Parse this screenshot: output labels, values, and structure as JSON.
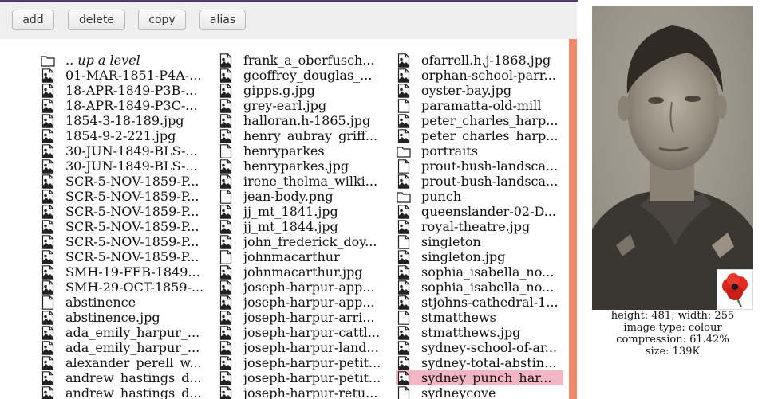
{
  "toolbar": {
    "add_label": "add",
    "delete_label": "delete",
    "copy_label": "copy",
    "alias_label": "alias"
  },
  "files": {
    "columns": [
      [
        {
          "name": ".. up a level",
          "icon": "folder-icon",
          "up": true
        },
        {
          "name": "01-MAR-1851-P4A-...",
          "icon": "image-file-icon"
        },
        {
          "name": "18-APR-1849-P3B-...",
          "icon": "image-file-icon"
        },
        {
          "name": "18-APR-1849-P3C-...",
          "icon": "image-file-icon"
        },
        {
          "name": "1854-3-18-189.jpg",
          "icon": "image-file-icon"
        },
        {
          "name": "1854-9-2-221.jpg",
          "icon": "image-file-icon"
        },
        {
          "name": "30-JUN-1849-BLS-...",
          "icon": "image-file-icon"
        },
        {
          "name": "30-JUN-1849-BLS-...",
          "icon": "image-file-icon"
        },
        {
          "name": "SCR-5-NOV-1859-P...",
          "icon": "image-file-icon"
        },
        {
          "name": "SCR-5-NOV-1859-P...",
          "icon": "image-file-icon"
        },
        {
          "name": "SCR-5-NOV-1859-P...",
          "icon": "image-file-icon"
        },
        {
          "name": "SCR-5-NOV-1859-P...",
          "icon": "image-file-icon"
        },
        {
          "name": "SCR-5-NOV-1859-P...",
          "icon": "image-file-icon"
        },
        {
          "name": "SCR-5-NOV-1859-P...",
          "icon": "image-file-icon"
        },
        {
          "name": "SMH-19-FEB-1849...",
          "icon": "image-file-icon"
        },
        {
          "name": "SMH-29-OCT-1859-...",
          "icon": "image-file-icon"
        },
        {
          "name": "abstinence",
          "icon": "blank-file-icon"
        },
        {
          "name": "abstinence.jpg",
          "icon": "image-file-icon"
        },
        {
          "name": "ada_emily_harpur_...",
          "icon": "image-file-icon"
        },
        {
          "name": "ada_emily_harpur_...",
          "icon": "image-file-icon"
        },
        {
          "name": "alexander_perell_w...",
          "icon": "image-file-icon"
        },
        {
          "name": "andrew_hastings_d...",
          "icon": "image-file-icon"
        },
        {
          "name": "andrew_hastings_d...",
          "icon": "image-file-icon"
        }
      ],
      [
        {
          "name": "frank_a_oberfusch...",
          "icon": "image-file-icon"
        },
        {
          "name": "geoffrey_douglas_...",
          "icon": "image-file-icon"
        },
        {
          "name": "gipps.g.jpg",
          "icon": "image-file-icon"
        },
        {
          "name": "grey-earl.jpg",
          "icon": "image-file-icon"
        },
        {
          "name": "halloran.h-1865.jpg",
          "icon": "image-file-icon"
        },
        {
          "name": "henry_aubray_griff...",
          "icon": "image-file-icon"
        },
        {
          "name": "henryparkes",
          "icon": "blank-file-icon"
        },
        {
          "name": "henryparkes.jpg",
          "icon": "image-file-icon"
        },
        {
          "name": "irene_thelma_wilki...",
          "icon": "image-file-icon"
        },
        {
          "name": "jean-body.png",
          "icon": "blank-file-icon"
        },
        {
          "name": "jj_mt_1841.jpg",
          "icon": "image-file-icon"
        },
        {
          "name": "jj_mt_1844.jpg",
          "icon": "image-file-icon"
        },
        {
          "name": "john_frederick_doy...",
          "icon": "image-file-icon"
        },
        {
          "name": "johnmacarthur",
          "icon": "blank-file-icon"
        },
        {
          "name": "johnmacarthur.jpg",
          "icon": "image-file-icon"
        },
        {
          "name": "joseph-harpur-app...",
          "icon": "image-file-icon"
        },
        {
          "name": "joseph-harpur-app...",
          "icon": "image-file-icon"
        },
        {
          "name": "joseph-harpur-arri...",
          "icon": "image-file-icon"
        },
        {
          "name": "joseph-harpur-cattl...",
          "icon": "image-file-icon"
        },
        {
          "name": "joseph-harpur-land...",
          "icon": "image-file-icon"
        },
        {
          "name": "joseph-harpur-petit...",
          "icon": "image-file-icon"
        },
        {
          "name": "joseph-harpur-petit...",
          "icon": "image-file-icon"
        },
        {
          "name": "joseph-harpur-retu...",
          "icon": "image-file-icon"
        }
      ],
      [
        {
          "name": "ofarrell.h.j-1868.jpg",
          "icon": "image-file-icon"
        },
        {
          "name": "orphan-school-parr...",
          "icon": "image-file-icon"
        },
        {
          "name": "oyster-bay.jpg",
          "icon": "image-file-icon"
        },
        {
          "name": "paramatta-old-mill",
          "icon": "blank-file-icon"
        },
        {
          "name": "peter_charles_harp...",
          "icon": "image-file-icon"
        },
        {
          "name": "peter_charles_harp...",
          "icon": "image-file-icon"
        },
        {
          "name": "portraits",
          "icon": "folder-icon"
        },
        {
          "name": "prout-bush-landsca...",
          "icon": "blank-file-icon"
        },
        {
          "name": "prout-bush-landsca...",
          "icon": "image-file-icon"
        },
        {
          "name": "punch",
          "icon": "folder-icon"
        },
        {
          "name": "queenslander-02-D...",
          "icon": "image-file-icon"
        },
        {
          "name": "royal-theatre.jpg",
          "icon": "image-file-icon"
        },
        {
          "name": "singleton",
          "icon": "blank-file-icon"
        },
        {
          "name": "singleton.jpg",
          "icon": "image-file-icon"
        },
        {
          "name": "sophia_isabella_no...",
          "icon": "image-file-icon"
        },
        {
          "name": "sophia_isabella_no...",
          "icon": "image-file-icon"
        },
        {
          "name": "stjohns-cathedral-1...",
          "icon": "image-file-icon"
        },
        {
          "name": "stmatthews",
          "icon": "blank-file-icon"
        },
        {
          "name": "stmatthews.jpg",
          "icon": "image-file-icon"
        },
        {
          "name": "sydney-school-of-ar...",
          "icon": "image-file-icon"
        },
        {
          "name": "sydney-total-abstin...",
          "icon": "image-file-icon"
        },
        {
          "name": "sydney_punch_har...",
          "icon": "image-file-icon",
          "selected": true
        },
        {
          "name": "sydneycove",
          "icon": "blank-file-icon"
        }
      ]
    ]
  },
  "preview": {
    "dimensions": "height: 481; width: 255",
    "image_type": "image type: colour",
    "compression": "compression: 61.42%",
    "size": "size: 139K"
  },
  "colors": {
    "scrollbar": "#ec8c6a",
    "selection": "#f4b6c2",
    "toolbar_bg": "#efefef",
    "title_strip": "#5a3b6e"
  }
}
